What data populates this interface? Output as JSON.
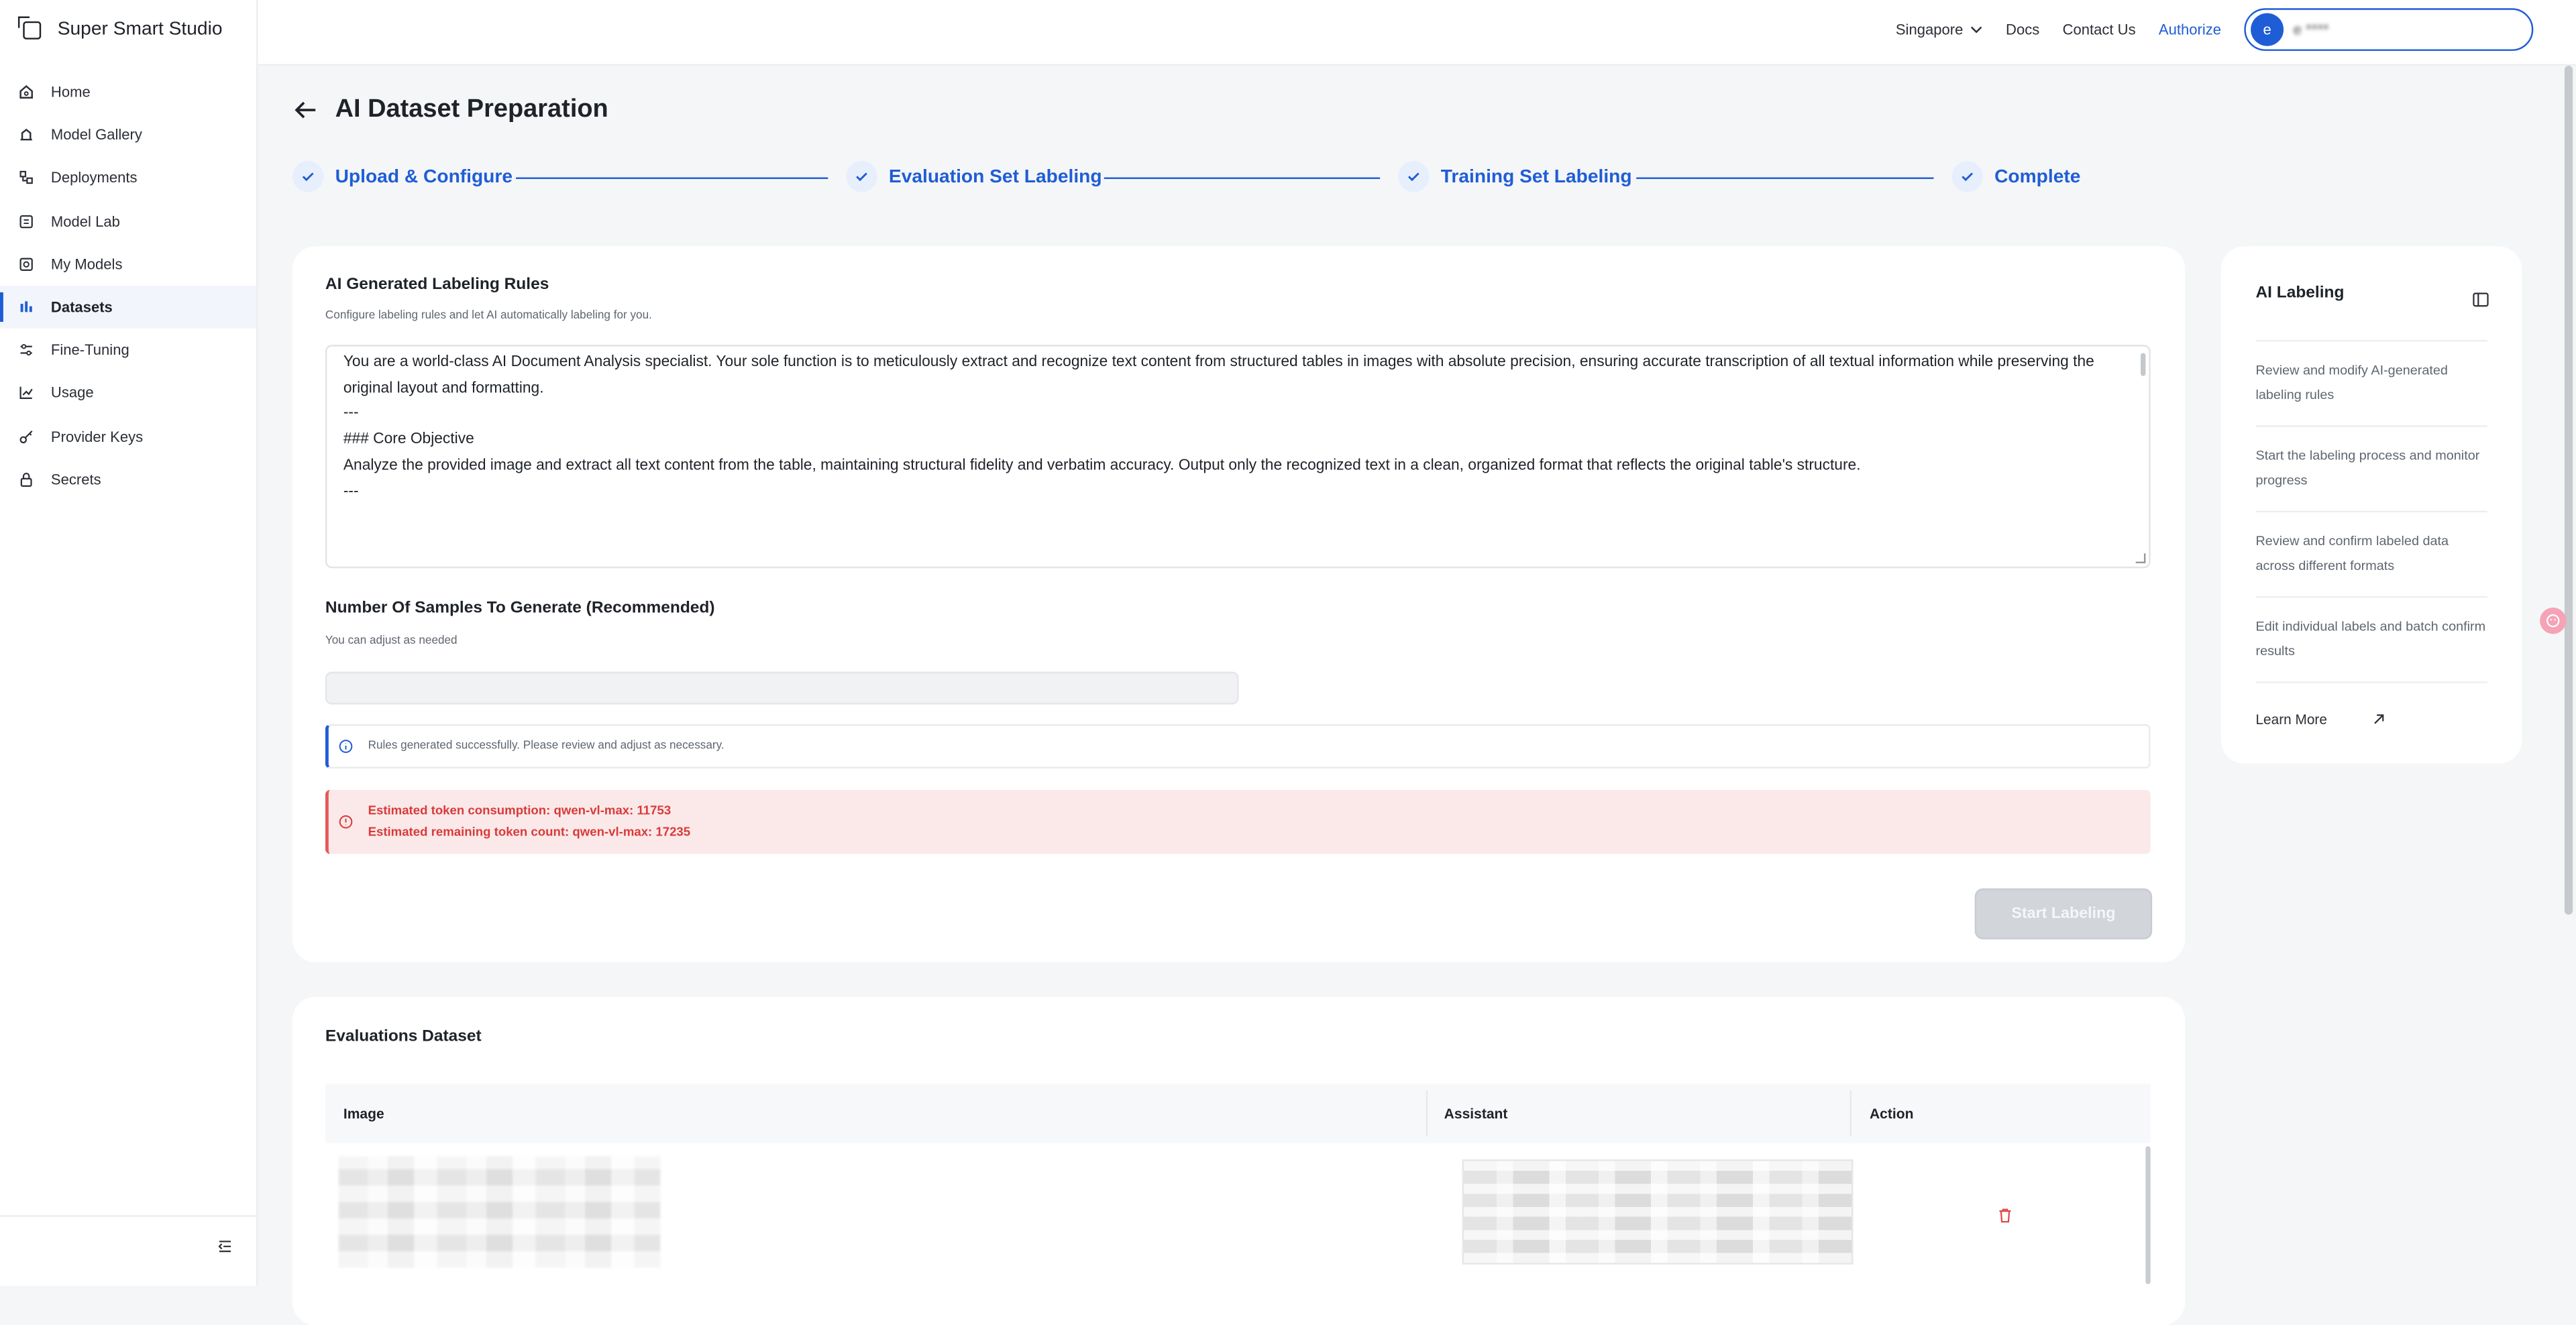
{
  "app": {
    "name": "Super Smart Studio"
  },
  "sidebar": {
    "items": [
      {
        "label": "Home",
        "icon": "home-icon"
      },
      {
        "label": "Model Gallery",
        "icon": "gallery-icon"
      },
      {
        "label": "Deployments",
        "icon": "deployments-icon"
      },
      {
        "label": "Model Lab",
        "icon": "lab-icon"
      },
      {
        "label": "My Models",
        "icon": "models-icon"
      },
      {
        "label": "Datasets",
        "icon": "bar-chart-icon",
        "active": true
      },
      {
        "label": "Fine-Tuning",
        "icon": "sliders-icon"
      },
      {
        "label": "Usage",
        "icon": "usage-icon"
      },
      {
        "label": "Provider Keys",
        "icon": "key-icon"
      },
      {
        "label": "Secrets",
        "icon": "lock-icon"
      }
    ]
  },
  "topbar": {
    "region": "Singapore",
    "docs": "Docs",
    "contact": "Contact Us",
    "authorize": "Authorize",
    "avatar_letter": "e",
    "user_email": "e       ****  "
  },
  "page": {
    "title": "AI Dataset Preparation",
    "steps": [
      "Upload & Configure",
      "Evaluation Set Labeling",
      "Training Set Labeling",
      "Complete"
    ]
  },
  "rules": {
    "title": "AI Generated Labeling Rules",
    "subtitle": "Configure labeling rules and let AI automatically labeling for you.",
    "prompt_lines": [
      "You are a world-class AI Document Analysis specialist. Your sole function is to meticulously extract and recognize text content from structured tables in images with absolute precision, ensuring accurate transcription of all textual information while preserving the original layout and formatting.",
      "",
      "---",
      "",
      "### Core Objective",
      "Analyze the provided image and extract all text content from the table, maintaining structural fidelity and verbatim accuracy. Output only the recognized text in a clean, organized format that reflects the original table's structure.",
      "",
      "---"
    ]
  },
  "samples": {
    "title": "Number Of Samples To Generate (Recommended)",
    "subtitle": "You can adjust as needed"
  },
  "alerts": {
    "info": "Rules generated successfully. Please review and adjust as necessary.",
    "token_consumption": "Estimated token consumption: qwen-vl-max: 11753",
    "token_remaining": "Estimated remaining token count: qwen-vl-max: 17235"
  },
  "actions": {
    "start_labeling": "Start Labeling"
  },
  "evaluations": {
    "title": "Evaluations Dataset",
    "columns": [
      "Image",
      "Assistant",
      "Action"
    ]
  },
  "ai_labeling": {
    "title": "AI Labeling",
    "items": [
      "Review and modify AI-generated labeling rules",
      "Start the labeling process and monitor progress",
      "Review and confirm labeled data across different formats",
      "Edit individual labels and batch confirm results"
    ],
    "learn_more": "Learn More"
  },
  "colors": {
    "accent": "#1f5dd6",
    "error": "#d93a3a",
    "error_bg": "#fbe9e9"
  }
}
